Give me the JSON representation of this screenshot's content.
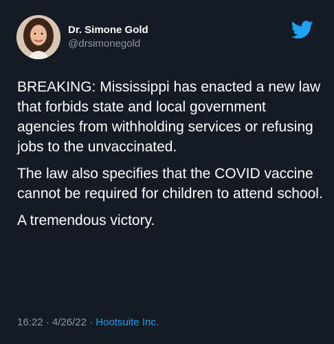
{
  "author": {
    "display_name": "Dr. Simone Gold",
    "handle": "@drsimonegold",
    "avatar_icon": "user-avatar-photo"
  },
  "brand_icon": "twitter-bird-icon",
  "colors": {
    "background": "#141b24",
    "text": "#ffffff",
    "muted": "#8899a6",
    "accent": "#1da1f2"
  },
  "tweet": {
    "paragraphs": [
      "BREAKING: Mississippi has enacted a new law that forbids state and local government agencies from withholding services or refusing jobs to the unvaccinated.",
      "The law also specifies that the COVID vaccine cannot be required for children to attend school.",
      "A tremendous victory."
    ]
  },
  "meta": {
    "time": "16:22",
    "sep1": " · ",
    "date": "4/26/22",
    "sep2": " · ",
    "source": "Hootsuite Inc."
  }
}
